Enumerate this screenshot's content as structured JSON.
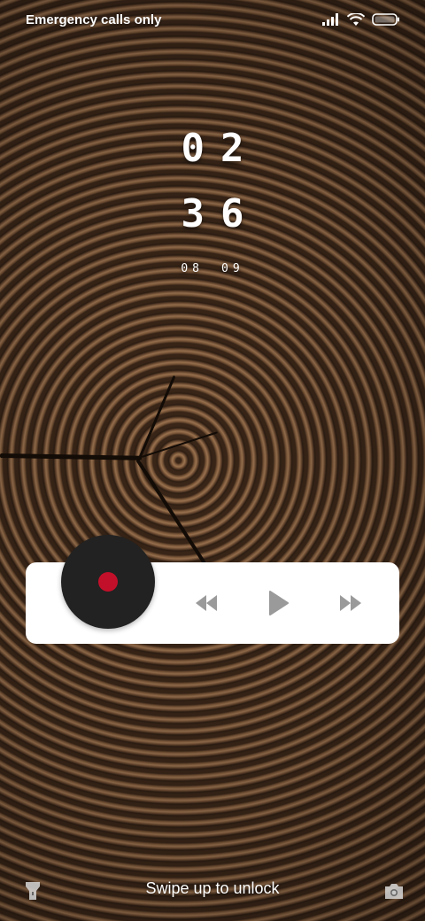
{
  "status_bar": {
    "carrier": "Emergency calls only",
    "icons": [
      "signal-icon",
      "wifi-icon",
      "battery-icon"
    ]
  },
  "clock": {
    "hours": "02",
    "minutes": "36",
    "date_month": "08",
    "date_day": "09"
  },
  "music": {
    "controls": [
      "previous-icon",
      "play-icon",
      "next-icon"
    ],
    "accent": "#c3102a",
    "control_color": "#9a9a9a"
  },
  "bottom": {
    "unlock_hint": "Swipe up to unlock",
    "left_icon": "flashlight-icon",
    "right_icon": "camera-icon"
  }
}
